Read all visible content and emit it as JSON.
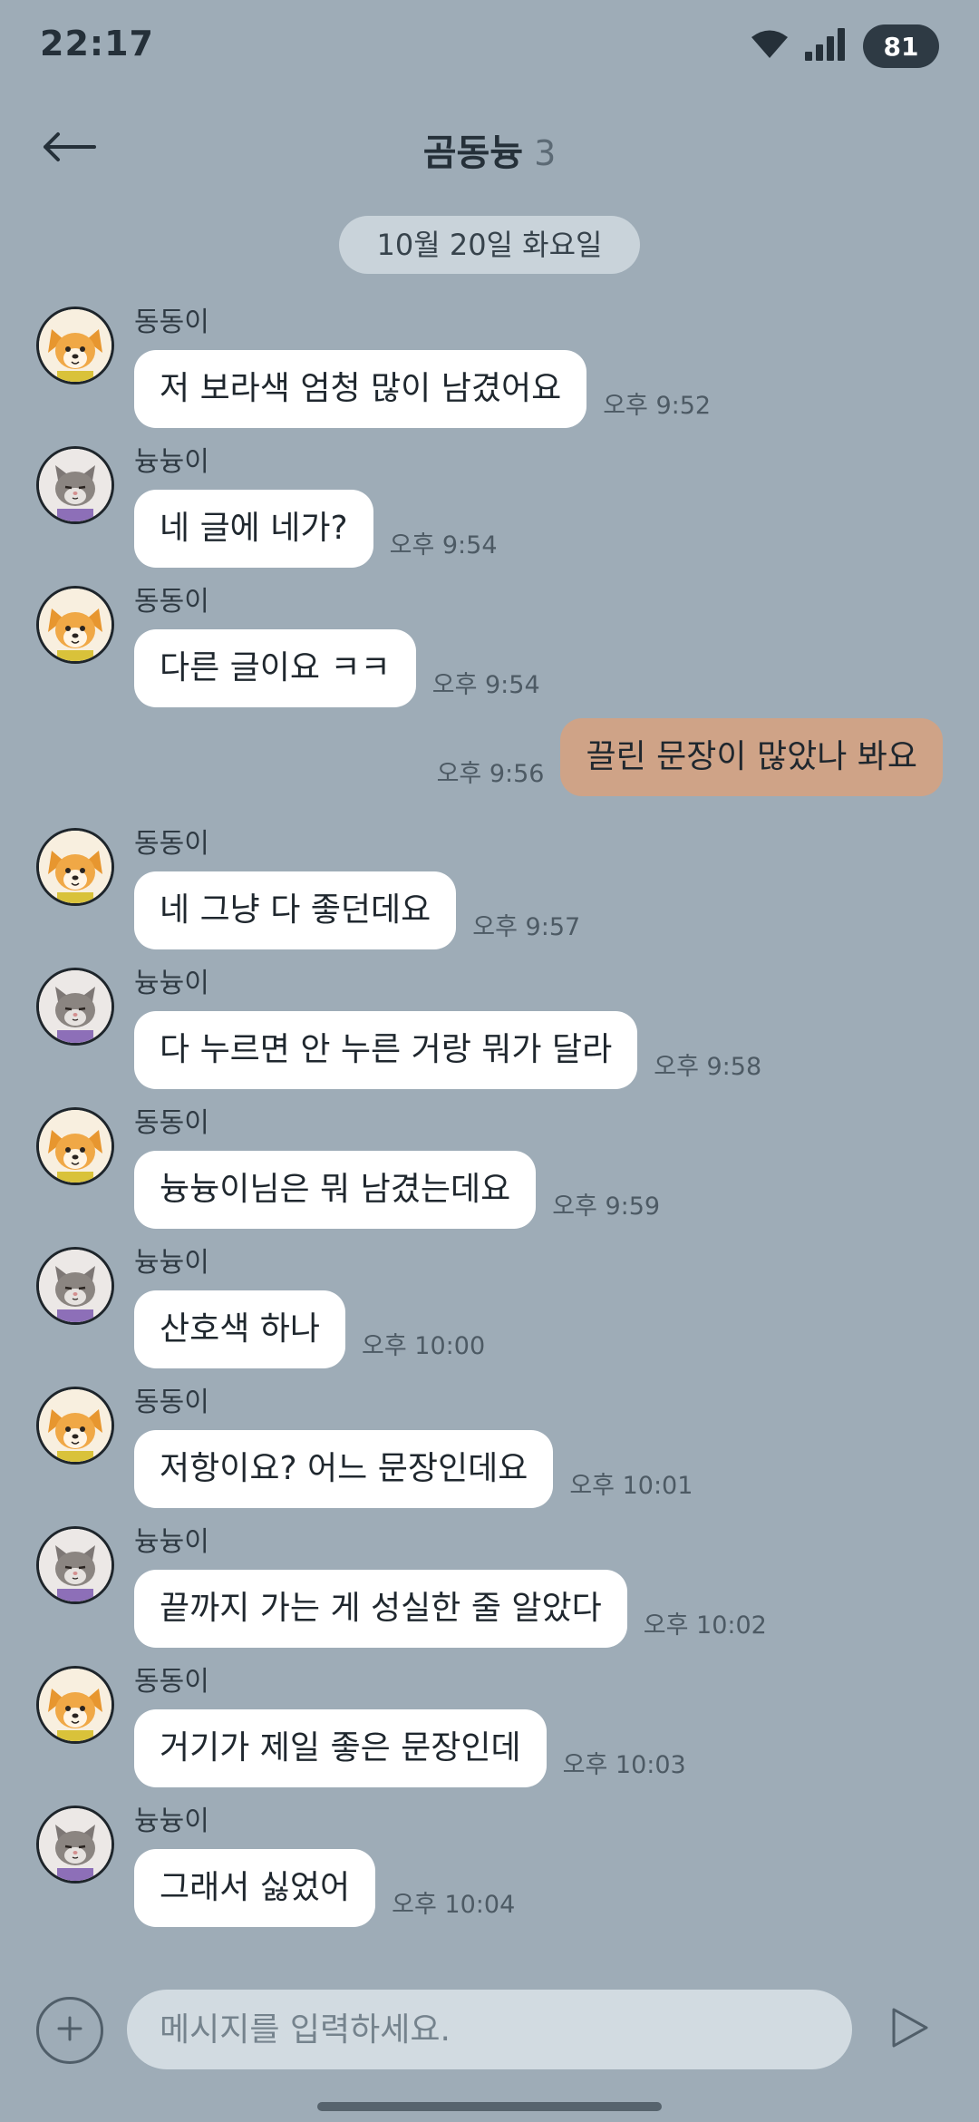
{
  "status_bar": {
    "time": "22:17",
    "battery": "81",
    "icons": [
      "wifi-icon",
      "signal-icon",
      "battery-icon"
    ]
  },
  "header": {
    "back_icon": "back-arrow-icon",
    "title": "곰동늉",
    "member_count": "3"
  },
  "date_divider": "10월 20일 화요일",
  "messages": [
    {
      "direction": "in",
      "sender": "동동이",
      "avatar": "dog",
      "text": "저 보라색 엄청 많이 남겼어요",
      "time": "오후 9:52"
    },
    {
      "direction": "in",
      "sender": "늉늉이",
      "avatar": "cat",
      "text": "네 글에 네가?",
      "time": "오후 9:54"
    },
    {
      "direction": "in",
      "sender": "동동이",
      "avatar": "dog",
      "text": "다른 글이요 ㅋㅋ",
      "time": "오후 9:54"
    },
    {
      "direction": "out",
      "sender": "",
      "avatar": "",
      "text": "끌린 문장이 많았나 봐요",
      "time": "오후 9:56"
    },
    {
      "direction": "in",
      "sender": "동동이",
      "avatar": "dog",
      "text": "네 그냥 다 좋던데요",
      "time": "오후 9:57"
    },
    {
      "direction": "in",
      "sender": "늉늉이",
      "avatar": "cat",
      "text": "다 누르면 안 누른 거랑 뭐가 달라",
      "time": "오후 9:58"
    },
    {
      "direction": "in",
      "sender": "동동이",
      "avatar": "dog",
      "text": "늉늉이님은 뭐 남겼는데요",
      "time": "오후 9:59"
    },
    {
      "direction": "in",
      "sender": "늉늉이",
      "avatar": "cat",
      "text": "산호색 하나",
      "time": "오후 10:00"
    },
    {
      "direction": "in",
      "sender": "동동이",
      "avatar": "dog",
      "text": "저항이요? 어느 문장인데요",
      "time": "오후 10:01"
    },
    {
      "direction": "in",
      "sender": "늉늉이",
      "avatar": "cat",
      "text": "끝까지 가는 게 성실한 줄 알았다",
      "time": "오후 10:02"
    },
    {
      "direction": "in",
      "sender": "동동이",
      "avatar": "dog",
      "text": "거기가 제일 좋은 문장인데",
      "time": "오후 10:03"
    },
    {
      "direction": "in",
      "sender": "늉늉이",
      "avatar": "cat",
      "text": "그래서 싫었어",
      "time": "오후 10:04"
    }
  ],
  "input_bar": {
    "plus_icon": "plus-icon",
    "placeholder": "메시지를 입력하세요.",
    "value": "",
    "send_icon": "send-icon"
  },
  "colors": {
    "background": "#9eacb7",
    "incoming_bubble": "#ffffff",
    "outgoing_bubble": "#cfa387",
    "date_chip": "#c9d3da",
    "input_field": "#d2dbe1"
  }
}
